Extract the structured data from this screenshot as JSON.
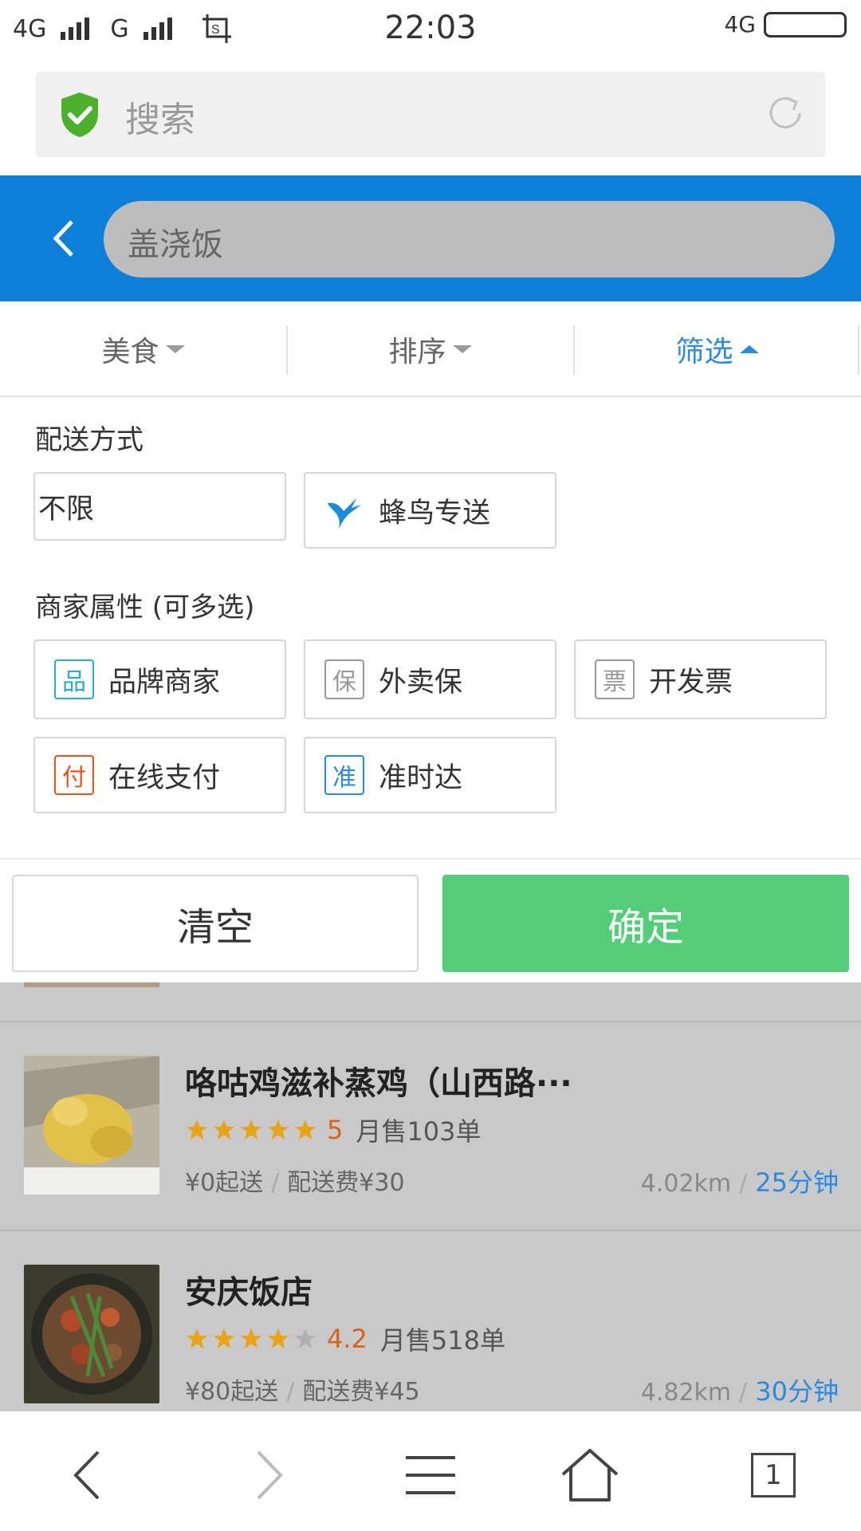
{
  "status_bar": {
    "network1": "4G",
    "network2": "G",
    "time": "22:03",
    "network_right": "4G"
  },
  "browser": {
    "search_placeholder": "搜索",
    "shield_icon": "shield-check-icon",
    "refresh_icon": "refresh-icon"
  },
  "header": {
    "query": "盖浇饭",
    "color": "#0d7fd6"
  },
  "tabs": [
    {
      "label": "美食",
      "active": false
    },
    {
      "label": "排序",
      "active": false
    },
    {
      "label": "筛选",
      "active": true
    }
  ],
  "filter": {
    "delivery_title": "配送方式",
    "delivery_options": [
      {
        "label": "不限"
      },
      {
        "label": "蜂鸟专送",
        "icon": "hummingbird-icon"
      }
    ],
    "attr_title": "商家属性 (可多选)",
    "attr_options": [
      {
        "badge": "品",
        "label": "品牌商家",
        "color": "#2aa8d8"
      },
      {
        "badge": "保",
        "label": "外卖保",
        "color": "#999999"
      },
      {
        "badge": "票",
        "label": "开发票",
        "color": "#999999"
      },
      {
        "badge": "付",
        "label": "在线支付",
        "color": "#e8541e"
      },
      {
        "badge": "准",
        "label": "准时达",
        "color": "#2d8ae0"
      }
    ],
    "clear_label": "清空",
    "confirm_label": "确定",
    "confirm_color": "#55cc77"
  },
  "restaurants": [
    {
      "name": "咯咕鸡滋补蒸鸡（山西路···",
      "rating": 5,
      "score": "5",
      "sales": "月售103单",
      "min_order": "¥0起送",
      "delivery_fee": "配送费¥30",
      "distance": "4.02km",
      "time": "25分钟"
    },
    {
      "name": "安庆饭店",
      "rating": 4.2,
      "score": "4.2",
      "sales": "月售518单",
      "min_order": "¥80起送",
      "delivery_fee": "配送费¥45",
      "distance": "4.82km",
      "time": "30分钟"
    }
  ],
  "nav": {
    "tab_count": "1"
  }
}
